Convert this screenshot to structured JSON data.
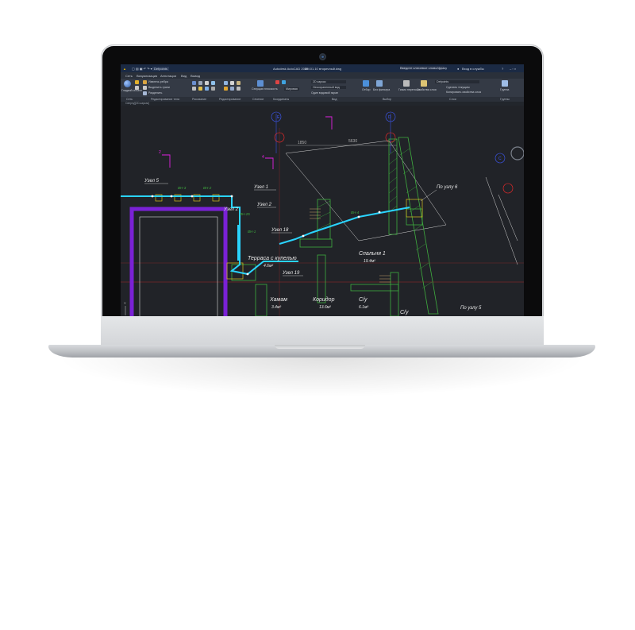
{
  "window": {
    "app_title": "Autodesk AutoCAD 2020",
    "file_name": "КМ.01.10 вторичный.dwg",
    "search_placeholder": "Введите ключевое слово/фразу",
    "signin_label": "Вход в службы",
    "layer_name": "Defpoints"
  },
  "menu": {
    "tabs": [
      "Сеть",
      "Визуализация",
      "Аннотации",
      "Вид",
      "Вывод"
    ]
  },
  "ribbon": {
    "groups": [
      "Сеть",
      "Редактирование тела",
      "Рисование",
      "Редактирование",
      "Сечение",
      "Координаты",
      "Вид",
      "Выбор",
      "Слои",
      "Группы"
    ],
    "items": {
      "smooth_object": "Гладкий объект",
      "extract_edges": "Извлечь ребра",
      "highlight_edges": "Выделить грани",
      "separate": "Разделить",
      "section_plane": "Секущая плоскость",
      "world": "Мировая",
      "view_2d": "2D каркас",
      "unsaved_view": "Несохраненный вид",
      "one_viewport": "Один видовой экран",
      "culling": "Отбор",
      "no_filter": "Без фильтра",
      "gizmo": "Гизмо переноса",
      "layer_props": "Свойства слоя",
      "make_current": "Сделать текущим",
      "match_layer": "Копировать свойства слоя",
      "group": "Группа",
      "layer_dropdown": "Defpoints"
    }
  },
  "doc_tab": "Сверху][2D-каркас]",
  "drawing": {
    "labels": {
      "uzel5": "Узел 5",
      "uzel1": "Узел 1",
      "uzel2": "Узел 2",
      "uzel18": "Узел 18",
      "uzel19": "Узел 19",
      "po_uzlu6": "По узлу 6",
      "po_uzlu5": "По узлу 5",
      "terrace": "Терраса с купелью",
      "terrace_area": "4.6м²",
      "bedroom": "Спальня 1",
      "bedroom_area": "19.4м²",
      "hamam": "Хамам",
      "hamam_area": "3.4м²",
      "corridor": "Коридор",
      "corridor_area": "13.6м²",
      "wc1": "С/у",
      "wc1_area": "6.1м²",
      "wc2": "С/у",
      "dim1": "1850",
      "dim2": "5630",
      "vn1": "ВН-3",
      "vn2": "ВН-2",
      "vn3": "ВН-25",
      "vn4": "ВН-1",
      "vn5": "ВН-4",
      "mark2": "2",
      "mark4": "4",
      "mark_e": "E",
      "mark_d": "D",
      "mark_c": "C",
      "axis_y": "Y"
    }
  },
  "colors": {
    "canvas": "#212328",
    "ribbon": "#343a45",
    "title_bar": "#1b2a44",
    "wall_hatch": "#3fae3f",
    "pipe": "#2ad4ff",
    "magenta": "#e020e0",
    "red": "#ff2a2a",
    "blue": "#3f5bff",
    "purple": "#7a21d6"
  }
}
